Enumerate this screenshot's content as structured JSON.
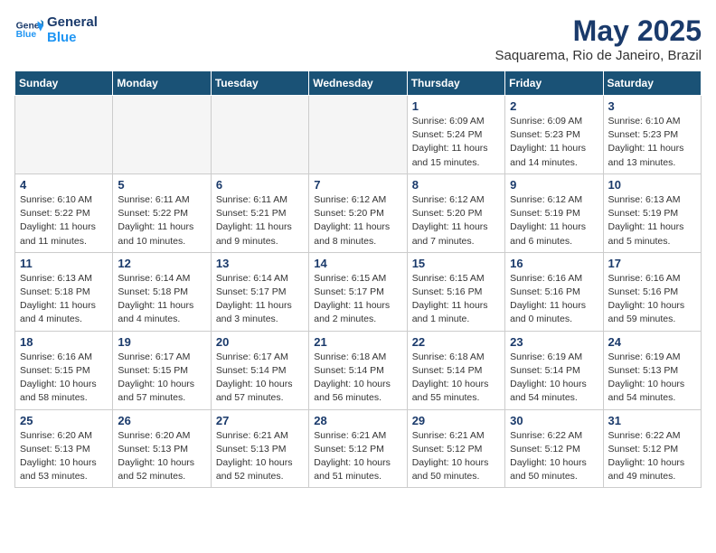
{
  "header": {
    "logo_line1": "General",
    "logo_line2": "Blue",
    "month": "May 2025",
    "location": "Saquarema, Rio de Janeiro, Brazil"
  },
  "weekdays": [
    "Sunday",
    "Monday",
    "Tuesday",
    "Wednesday",
    "Thursday",
    "Friday",
    "Saturday"
  ],
  "weeks": [
    [
      {
        "day": "",
        "info": "",
        "empty": true
      },
      {
        "day": "",
        "info": "",
        "empty": true
      },
      {
        "day": "",
        "info": "",
        "empty": true
      },
      {
        "day": "",
        "info": "",
        "empty": true
      },
      {
        "day": "1",
        "info": "Sunrise: 6:09 AM\nSunset: 5:24 PM\nDaylight: 11 hours\nand 15 minutes."
      },
      {
        "day": "2",
        "info": "Sunrise: 6:09 AM\nSunset: 5:23 PM\nDaylight: 11 hours\nand 14 minutes."
      },
      {
        "day": "3",
        "info": "Sunrise: 6:10 AM\nSunset: 5:23 PM\nDaylight: 11 hours\nand 13 minutes."
      }
    ],
    [
      {
        "day": "4",
        "info": "Sunrise: 6:10 AM\nSunset: 5:22 PM\nDaylight: 11 hours\nand 11 minutes."
      },
      {
        "day": "5",
        "info": "Sunrise: 6:11 AM\nSunset: 5:22 PM\nDaylight: 11 hours\nand 10 minutes."
      },
      {
        "day": "6",
        "info": "Sunrise: 6:11 AM\nSunset: 5:21 PM\nDaylight: 11 hours\nand 9 minutes."
      },
      {
        "day": "7",
        "info": "Sunrise: 6:12 AM\nSunset: 5:20 PM\nDaylight: 11 hours\nand 8 minutes."
      },
      {
        "day": "8",
        "info": "Sunrise: 6:12 AM\nSunset: 5:20 PM\nDaylight: 11 hours\nand 7 minutes."
      },
      {
        "day": "9",
        "info": "Sunrise: 6:12 AM\nSunset: 5:19 PM\nDaylight: 11 hours\nand 6 minutes."
      },
      {
        "day": "10",
        "info": "Sunrise: 6:13 AM\nSunset: 5:19 PM\nDaylight: 11 hours\nand 5 minutes."
      }
    ],
    [
      {
        "day": "11",
        "info": "Sunrise: 6:13 AM\nSunset: 5:18 PM\nDaylight: 11 hours\nand 4 minutes."
      },
      {
        "day": "12",
        "info": "Sunrise: 6:14 AM\nSunset: 5:18 PM\nDaylight: 11 hours\nand 4 minutes."
      },
      {
        "day": "13",
        "info": "Sunrise: 6:14 AM\nSunset: 5:17 PM\nDaylight: 11 hours\nand 3 minutes."
      },
      {
        "day": "14",
        "info": "Sunrise: 6:15 AM\nSunset: 5:17 PM\nDaylight: 11 hours\nand 2 minutes."
      },
      {
        "day": "15",
        "info": "Sunrise: 6:15 AM\nSunset: 5:16 PM\nDaylight: 11 hours\nand 1 minute."
      },
      {
        "day": "16",
        "info": "Sunrise: 6:16 AM\nSunset: 5:16 PM\nDaylight: 11 hours\nand 0 minutes."
      },
      {
        "day": "17",
        "info": "Sunrise: 6:16 AM\nSunset: 5:16 PM\nDaylight: 10 hours\nand 59 minutes."
      }
    ],
    [
      {
        "day": "18",
        "info": "Sunrise: 6:16 AM\nSunset: 5:15 PM\nDaylight: 10 hours\nand 58 minutes."
      },
      {
        "day": "19",
        "info": "Sunrise: 6:17 AM\nSunset: 5:15 PM\nDaylight: 10 hours\nand 57 minutes."
      },
      {
        "day": "20",
        "info": "Sunrise: 6:17 AM\nSunset: 5:14 PM\nDaylight: 10 hours\nand 57 minutes."
      },
      {
        "day": "21",
        "info": "Sunrise: 6:18 AM\nSunset: 5:14 PM\nDaylight: 10 hours\nand 56 minutes."
      },
      {
        "day": "22",
        "info": "Sunrise: 6:18 AM\nSunset: 5:14 PM\nDaylight: 10 hours\nand 55 minutes."
      },
      {
        "day": "23",
        "info": "Sunrise: 6:19 AM\nSunset: 5:14 PM\nDaylight: 10 hours\nand 54 minutes."
      },
      {
        "day": "24",
        "info": "Sunrise: 6:19 AM\nSunset: 5:13 PM\nDaylight: 10 hours\nand 54 minutes."
      }
    ],
    [
      {
        "day": "25",
        "info": "Sunrise: 6:20 AM\nSunset: 5:13 PM\nDaylight: 10 hours\nand 53 minutes."
      },
      {
        "day": "26",
        "info": "Sunrise: 6:20 AM\nSunset: 5:13 PM\nDaylight: 10 hours\nand 52 minutes."
      },
      {
        "day": "27",
        "info": "Sunrise: 6:21 AM\nSunset: 5:13 PM\nDaylight: 10 hours\nand 52 minutes."
      },
      {
        "day": "28",
        "info": "Sunrise: 6:21 AM\nSunset: 5:12 PM\nDaylight: 10 hours\nand 51 minutes."
      },
      {
        "day": "29",
        "info": "Sunrise: 6:21 AM\nSunset: 5:12 PM\nDaylight: 10 hours\nand 50 minutes."
      },
      {
        "day": "30",
        "info": "Sunrise: 6:22 AM\nSunset: 5:12 PM\nDaylight: 10 hours\nand 50 minutes."
      },
      {
        "day": "31",
        "info": "Sunrise: 6:22 AM\nSunset: 5:12 PM\nDaylight: 10 hours\nand 49 minutes."
      }
    ]
  ]
}
